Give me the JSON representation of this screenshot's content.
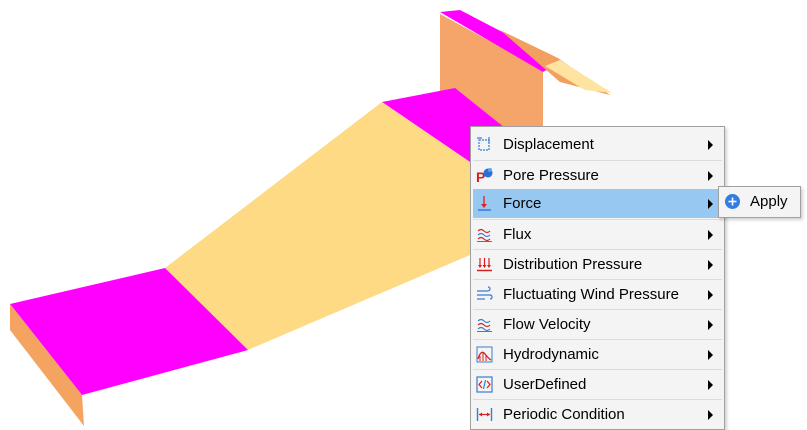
{
  "context_menu": {
    "items": [
      {
        "label": "Displacement",
        "icon": "displacement-icon"
      },
      {
        "label": "Pore Pressure",
        "icon": "pore-pressure-icon"
      },
      {
        "label": "Force",
        "icon": "force-icon",
        "highlighted": true
      },
      {
        "label": "Flux",
        "icon": "flux-icon"
      },
      {
        "label": "Distribution Pressure",
        "icon": "distribution-pressure-icon"
      },
      {
        "label": "Fluctuating Wind Pressure",
        "icon": "wind-pressure-icon"
      },
      {
        "label": "Flow Velocity",
        "icon": "flow-velocity-icon"
      },
      {
        "label": "Hydrodynamic",
        "icon": "hydrodynamic-icon"
      },
      {
        "label": "UserDefined",
        "icon": "user-defined-icon"
      },
      {
        "label": "Periodic Condition",
        "icon": "periodic-condition-icon"
      }
    ]
  },
  "submenu": {
    "apply_label": "Apply",
    "icon": "apply-plus-icon"
  },
  "colors": {
    "magenta_face": "#ff00ff",
    "cream_face": "#ffdc82",
    "orange_face": "#f4a460",
    "menu_bg": "#f4f4f4",
    "highlight": "#97c8f2"
  }
}
